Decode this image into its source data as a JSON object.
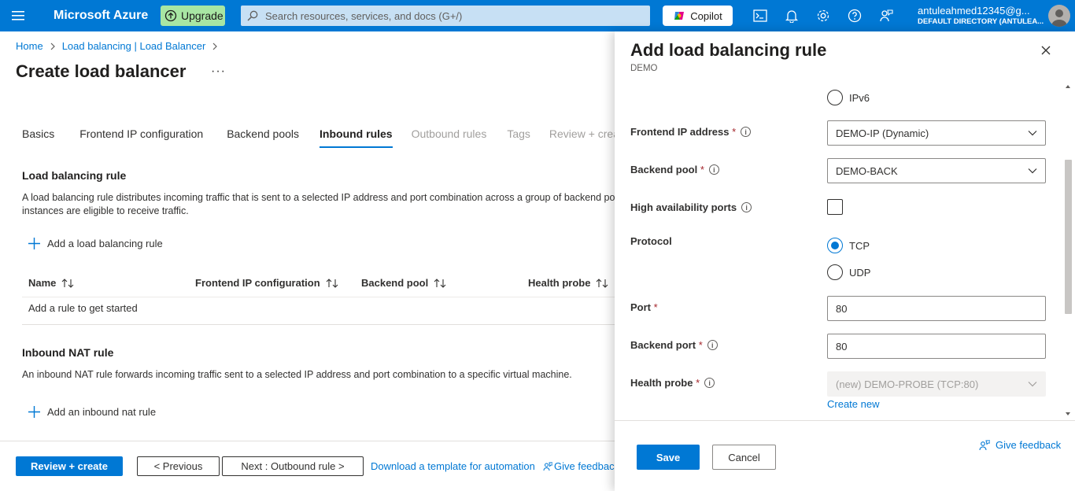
{
  "topbar": {
    "brand": "Microsoft Azure",
    "upgrade_label": "Upgrade",
    "search_placeholder": "Search resources, services, and docs (G+/)",
    "copilot_label": "Copilot",
    "account_email": "antuleahmed12345@g...",
    "account_directory": "DEFAULT DIRECTORY (ANTULEA..."
  },
  "breadcrumb": [
    "Home",
    "Load balancing | Load Balancer"
  ],
  "page": {
    "title": "Create load balancer",
    "more": "···"
  },
  "tabs": [
    {
      "label": "Basics",
      "state": "normal"
    },
    {
      "label": "Frontend IP configuration",
      "state": "normal"
    },
    {
      "label": "Backend pools",
      "state": "normal"
    },
    {
      "label": "Inbound rules",
      "state": "active"
    },
    {
      "label": "Outbound rules",
      "state": "disabled"
    },
    {
      "label": "Tags",
      "state": "disabled"
    },
    {
      "label": "Review + create",
      "state": "disabled"
    }
  ],
  "lb_rule": {
    "title": "Load balancing rule",
    "desc_line1": "A load balancing rule distributes incoming traffic that is sent to a selected IP address and port combination across a group of backend pool",
    "desc_line2": "instances are eligible to receive traffic.",
    "add_label": "Add a load balancing rule",
    "columns": [
      "Name",
      "Frontend IP configuration",
      "Backend pool",
      "Health probe"
    ],
    "empty_text": "Add a rule to get started"
  },
  "nat_rule": {
    "title": "Inbound NAT rule",
    "desc": "An inbound NAT rule forwards incoming traffic sent to a selected IP address and port combination to a specific virtual machine.",
    "add_label": "Add an inbound nat rule"
  },
  "footer": {
    "review_create": "Review + create",
    "previous": "< Previous",
    "next": "Next : Outbound rule >",
    "download": "Download a template for automation",
    "feedback": "Give feedback"
  },
  "panel": {
    "title": "Add load balancing rule",
    "subtitle": "DEMO",
    "ipv6_label": "IPv6",
    "frontend_ip_label": "Frontend IP address",
    "frontend_ip_value": "DEMO-IP (Dynamic)",
    "backend_pool_label": "Backend pool",
    "backend_pool_value": "DEMO-BACK",
    "ha_ports_label": "High availability ports",
    "protocol_label": "Protocol",
    "protocol_options": [
      "TCP",
      "UDP"
    ],
    "protocol_selected": "TCP",
    "port_label": "Port",
    "port_value": "80",
    "backend_port_label": "Backend port",
    "backend_port_value": "80",
    "health_probe_label": "Health probe",
    "health_probe_value": "(new) DEMO-PROBE (TCP:80)",
    "create_new": "Create new",
    "required_mark": "*",
    "save": "Save",
    "cancel": "Cancel",
    "feedback": "Give feedback"
  },
  "colors": {
    "azure_blue": "#0078d4",
    "upgrade_green": "#a8e6a3",
    "search_bg": "#c7e0f4"
  }
}
